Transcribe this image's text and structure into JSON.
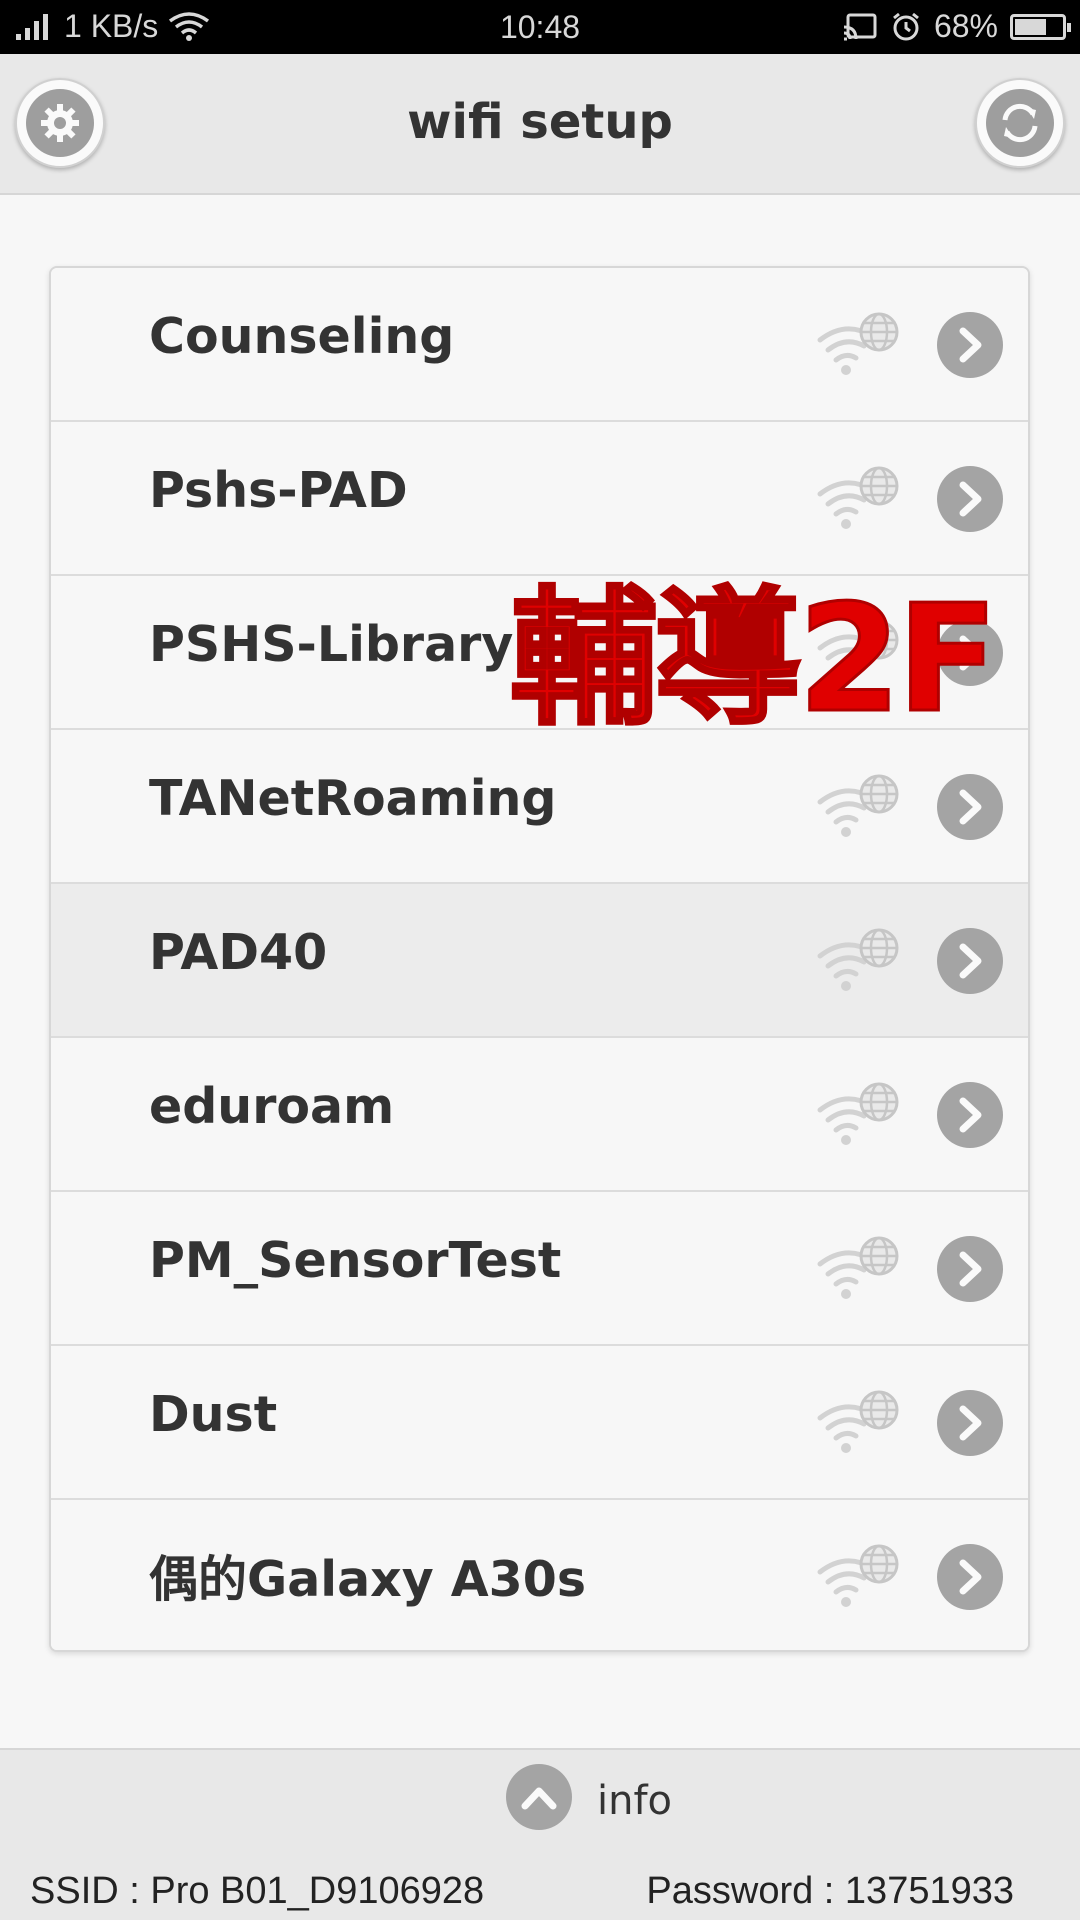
{
  "status_bar": {
    "net_speed": "1 KB/s",
    "time": "10:48",
    "battery": "68%",
    "battery_level": 0.68
  },
  "header": {
    "title": "wifi setup",
    "left_icon": "gear-icon",
    "right_icon": "refresh-icon"
  },
  "networks": [
    {
      "ssid": "Counseling"
    },
    {
      "ssid": "Pshs-PAD"
    },
    {
      "ssid": "PSHS-Library"
    },
    {
      "ssid": "TANetRoaming"
    },
    {
      "ssid": "PAD40",
      "selected": true
    },
    {
      "ssid": "eduroam"
    },
    {
      "ssid": "PM_SensorTest"
    },
    {
      "ssid": "Dust"
    },
    {
      "ssid": "偶的Galaxy A30s"
    }
  ],
  "overlay_text": "輔導2F",
  "footer": {
    "info_label": "info",
    "ssid_text": "SSID : Pro B01_D9106928",
    "password_text": "Password : 13751933"
  },
  "colors": {
    "header_bg": "#e8e8e8",
    "button_gray": "#a4a4a4",
    "overlay_red": "#e00000"
  }
}
